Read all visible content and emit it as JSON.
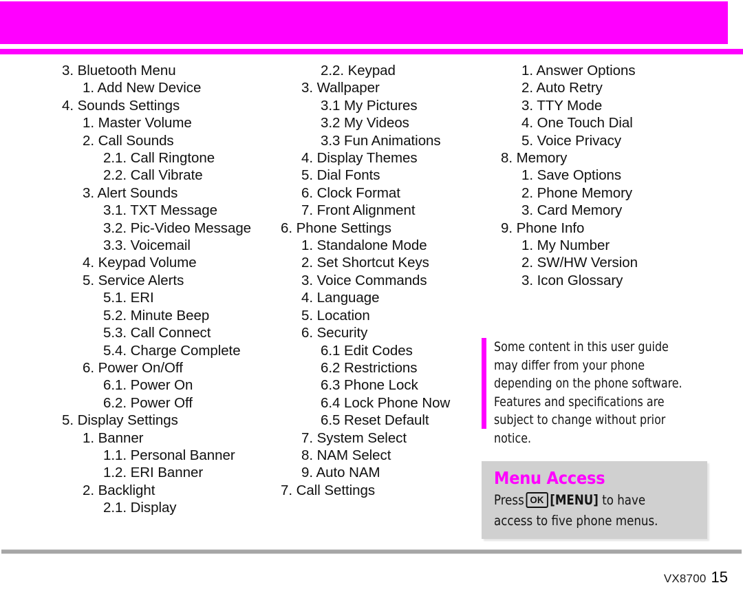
{
  "page": {
    "model": "VX8700",
    "page_number": "15",
    "accent_color": "#ff00ff",
    "box_color": "#d0d0d0",
    "rule_color": "#a6a6a6"
  },
  "columns": [
    {
      "name": "column-1",
      "lines": [
        {
          "text": "3. Bluetooth Menu",
          "level": 1
        },
        {
          "text": "1. Add New Device",
          "level": 2
        },
        {
          "text": "4. Sounds Settings",
          "level": 1
        },
        {
          "text": "1. Master Volume",
          "level": 2
        },
        {
          "text": "2. Call Sounds",
          "level": 2
        },
        {
          "text": "2.1. Call Ringtone",
          "level": 3
        },
        {
          "text": "2.2. Call Vibrate",
          "level": 3
        },
        {
          "text": "3. Alert Sounds",
          "level": 2
        },
        {
          "text": "3.1. TXT Message",
          "level": 3
        },
        {
          "text": "3.2. Pic-Video Message",
          "level": 3
        },
        {
          "text": "3.3. Voicemail",
          "level": 3
        },
        {
          "text": "4. Keypad Volume",
          "level": 2
        },
        {
          "text": "5. Service Alerts",
          "level": 2
        },
        {
          "text": "5.1. ERI",
          "level": 3
        },
        {
          "text": "5.2. Minute Beep",
          "level": 3
        },
        {
          "text": "5.3. Call Connect",
          "level": 3
        },
        {
          "text": "5.4. Charge Complete",
          "level": 3
        },
        {
          "text": "6.  Power On/Off",
          "level": 2
        },
        {
          "text": "6.1. Power On",
          "level": 3
        },
        {
          "text": "6.2. Power Off",
          "level": 3
        },
        {
          "text": "5. Display Settings",
          "level": 1
        },
        {
          "text": "1. Banner",
          "level": 2
        },
        {
          "text": "1.1. Personal Banner",
          "level": 3
        },
        {
          "text": "1.2. ERI Banner",
          "level": 3
        },
        {
          "text": "2. Backlight",
          "level": 2
        },
        {
          "text": "2.1. Display",
          "level": 3
        }
      ]
    },
    {
      "name": "column-2",
      "lines": [
        {
          "text": "2.2. Keypad",
          "level": 3
        },
        {
          "text": "3. Wallpaper",
          "level": 2
        },
        {
          "text": "3.1 My Pictures",
          "level": 3
        },
        {
          "text": "3.2 My Videos",
          "level": 3
        },
        {
          "text": "3.3 Fun Animations",
          "level": 3
        },
        {
          "text": "4. Display Themes",
          "level": 2
        },
        {
          "text": "5. Dial Fonts",
          "level": 2
        },
        {
          "text": "6. Clock Format",
          "level": 2
        },
        {
          "text": "7. Front Alignment",
          "level": 2
        },
        {
          "text": "6. Phone Settings",
          "level": 1
        },
        {
          "text": "1. Standalone Mode",
          "level": 2
        },
        {
          "text": "2. Set Shortcut Keys",
          "level": 2
        },
        {
          "text": "3. Voice Commands",
          "level": 2
        },
        {
          "text": "4. Language",
          "level": 2
        },
        {
          "text": "5. Location",
          "level": 2
        },
        {
          "text": "6. Security",
          "level": 2
        },
        {
          "text": "6.1 Edit Codes",
          "level": 3
        },
        {
          "text": "6.2 Restrictions",
          "level": 3
        },
        {
          "text": "6.3 Phone Lock",
          "level": 3
        },
        {
          "text": "6.4 Lock Phone Now",
          "level": 3
        },
        {
          "text": "6.5 Reset Default",
          "level": 3
        },
        {
          "text": "7. System Select",
          "level": 2
        },
        {
          "text": "8. NAM Select",
          "level": 2
        },
        {
          "text": "9. Auto NAM",
          "level": 2
        },
        {
          "text": "7. Call Settings",
          "level": 1
        }
      ]
    },
    {
      "name": "column-3",
      "lines": [
        {
          "text": "1. Answer Options",
          "level": 2
        },
        {
          "text": "2. Auto Retry",
          "level": 2
        },
        {
          "text": "3. TTY Mode",
          "level": 2
        },
        {
          "text": "4. One Touch Dial",
          "level": 2
        },
        {
          "text": "5. Voice Privacy",
          "level": 2
        },
        {
          "text": "8. Memory",
          "level": 1
        },
        {
          "text": "1. Save Options",
          "level": 2
        },
        {
          "text": "2. Phone Memory",
          "level": 2
        },
        {
          "text": "3. Card Memory",
          "level": 2
        },
        {
          "text": "9. Phone Info",
          "level": 1
        },
        {
          "text": "1. My Number",
          "level": 2
        },
        {
          "text": "2. SW/HW Version",
          "level": 2
        },
        {
          "text": "3. Icon Glossary",
          "level": 2
        }
      ]
    }
  ],
  "note": {
    "text": "Some content in this user guide may differ from your phone depending on the phone software. Features and specifications are subject to change without prior notice."
  },
  "menu_access": {
    "title": "Menu Access",
    "press_label": "Press",
    "key_label": "OK",
    "menu_label": "[MENU]",
    "tail_text": "to have access to five phone menus."
  }
}
